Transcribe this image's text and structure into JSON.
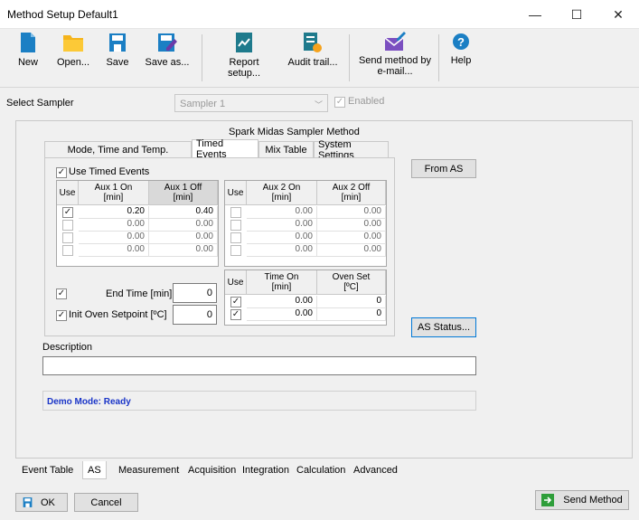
{
  "window": {
    "title": "Method Setup Default1",
    "minimize": "—",
    "maximize": "☐",
    "close": "✕"
  },
  "toolbar": {
    "new": "New",
    "open": "Open...",
    "save": "Save",
    "save_as": "Save as...",
    "report_setup": "Report setup...",
    "audit_trail": "Audit trail...",
    "send_email_1": "Send method by",
    "send_email_2": "e-mail...",
    "help": "Help"
  },
  "sampler": {
    "label": "Select Sampler",
    "value": "Sampler 1",
    "enabled_label": "Enabled"
  },
  "method_title": "Spark Midas Sampler Method",
  "tabs": [
    "Mode, Time and Temp.",
    "Timed Events",
    "Mix Table",
    "System Settings"
  ],
  "use_timed_events": "Use Timed Events",
  "aux1": {
    "h_use": "Use",
    "h_on": "Aux 1 On\n[min]",
    "h_off": "Aux 1 Off\n[min]",
    "rows": [
      {
        "use": true,
        "on": "0.20",
        "off": "0.40"
      },
      {
        "use": false,
        "on": "0.00",
        "off": "0.00"
      },
      {
        "use": false,
        "on": "0.00",
        "off": "0.00"
      },
      {
        "use": false,
        "on": "0.00",
        "off": "0.00"
      }
    ]
  },
  "aux2": {
    "h_use": "Use",
    "h_on": "Aux 2 On\n[min]",
    "h_off": "Aux 2 Off\n[min]",
    "rows": [
      {
        "use": false,
        "on": "0.00",
        "off": "0.00"
      },
      {
        "use": false,
        "on": "0.00",
        "off": "0.00"
      },
      {
        "use": false,
        "on": "0.00",
        "off": "0.00"
      },
      {
        "use": false,
        "on": "0.00",
        "off": "0.00"
      }
    ]
  },
  "oven": {
    "h_use": "Use",
    "h_time": "Time On\n[min]",
    "h_set": "Oven Set\n[ºC]",
    "rows": [
      {
        "use": true,
        "time": "0.00",
        "set": "0"
      },
      {
        "use": true,
        "time": "0.00",
        "set": "0"
      }
    ]
  },
  "end_time": {
    "label": "End Time [min]",
    "value": "0"
  },
  "init_oven": {
    "label": "Init Oven Setpoint [ºC]",
    "value": "0"
  },
  "from_as": "From AS",
  "as_status": "AS Status...",
  "description_label": "Description",
  "status_text": "Demo Mode: Ready",
  "bottom_tabs": [
    "Event Table",
    "AS",
    "Measurement",
    "Acquisition",
    "Integration",
    "Calculation",
    "Advanced"
  ],
  "ok": "OK",
  "cancel": "Cancel",
  "send_method": "Send Method",
  "colors": {
    "accent": "#1b7fc4",
    "status_text": "#1a35c8",
    "green": "#2e9e3a"
  }
}
